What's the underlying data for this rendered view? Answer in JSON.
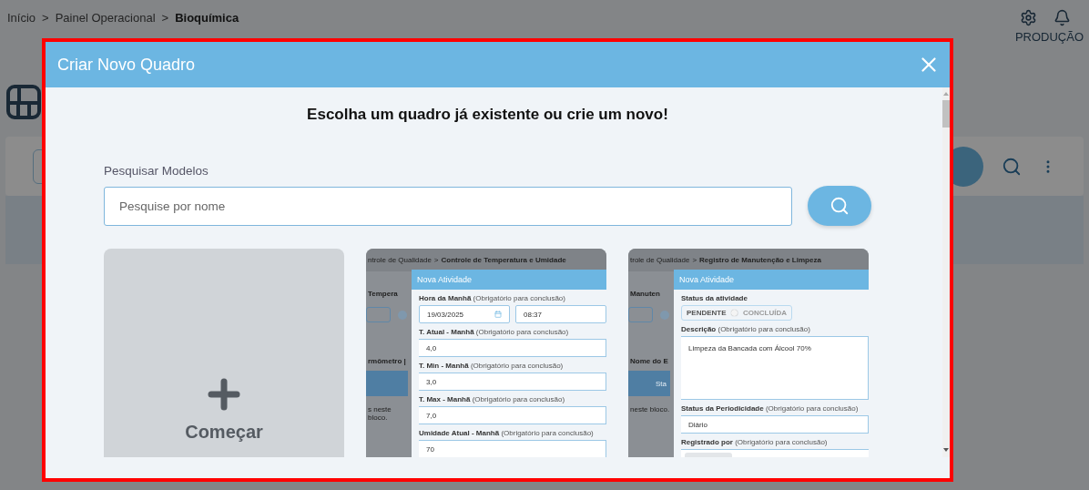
{
  "breadcrumb": [
    {
      "kind": "link",
      "label": "Início"
    },
    {
      "kind": "separator",
      "label": ">"
    },
    {
      "kind": "link",
      "label": "Painel Operacional"
    },
    {
      "kind": "separator",
      "label": ">"
    },
    {
      "kind": "current",
      "label": "Bioquímica"
    }
  ],
  "user_label": "PRODUÇÃO",
  "modal": {
    "title": "Criar Novo Quadro",
    "heading": "Escolha um quadro já existente ou crie um novo!",
    "search": {
      "label": "Pesquisar Modelos",
      "placeholder": "Pesquise por nome"
    },
    "cards": [
      {
        "kind": "new",
        "label": "Começar"
      },
      {
        "kind": "template",
        "thumbnail": {
          "crumb": "ntrole de Qualidade",
          "separator": ">",
          "crumb_current": "Controle de Temperatura e Umidade",
          "page_title": "Tempera",
          "table_title": "rmômetro |",
          "footer": "s neste bloco.",
          "dialog": {
            "title": "Nova Atividade",
            "fields": [
              {
                "kind": "datetime",
                "label": "Hora da Manhã",
                "hint": "(Obrigatório para conclusão)",
                "values": [
                  "19/03/2025",
                  "08:37"
                ]
              },
              {
                "kind": "text",
                "label": "T. Atual - Manhã",
                "hint": "(Obrigatório para conclusão)",
                "value": "4,0"
              },
              {
                "kind": "text",
                "label": "T. Min - Manhã",
                "hint": "(Obrigatório para conclusão)",
                "value": "3,0"
              },
              {
                "kind": "text",
                "label": "T. Max - Manhã",
                "hint": "(Obrigatório para conclusão)",
                "value": "7,0"
              },
              {
                "kind": "text",
                "label": "Umidade Atual - Manhã",
                "hint": "(Obrigatório para conclusão)",
                "value": "70"
              }
            ]
          }
        }
      },
      {
        "kind": "template",
        "thumbnail": {
          "crumb": "trole de Qualidade",
          "separator": ">",
          "crumb_current": "Registro de Manutenção e Limpeza",
          "page_title": "Manuten",
          "table_title": "Nome do E",
          "table_header": "Sta",
          "footer": "neste bloco.",
          "dialog": {
            "title": "Nova Atividade",
            "fields": [
              {
                "kind": "toggle",
                "label": "Status da atividade",
                "options": [
                  "PENDENTE",
                  "CONCLUÍDA"
                ],
                "on": false
              },
              {
                "kind": "textarea",
                "label": "Descrição",
                "hint": "(Obrigatório para conclusão)",
                "value": "Limpeza da Bancada com Álcool 70%"
              },
              {
                "kind": "text",
                "label": "Status da Periodicidade",
                "hint": "(Obrigatório para conclusão)",
                "value": "Diário"
              },
              {
                "kind": "chip",
                "label": "Registrado por",
                "hint": "(Obrigatório para conclusão)"
              }
            ]
          }
        }
      }
    ]
  }
}
